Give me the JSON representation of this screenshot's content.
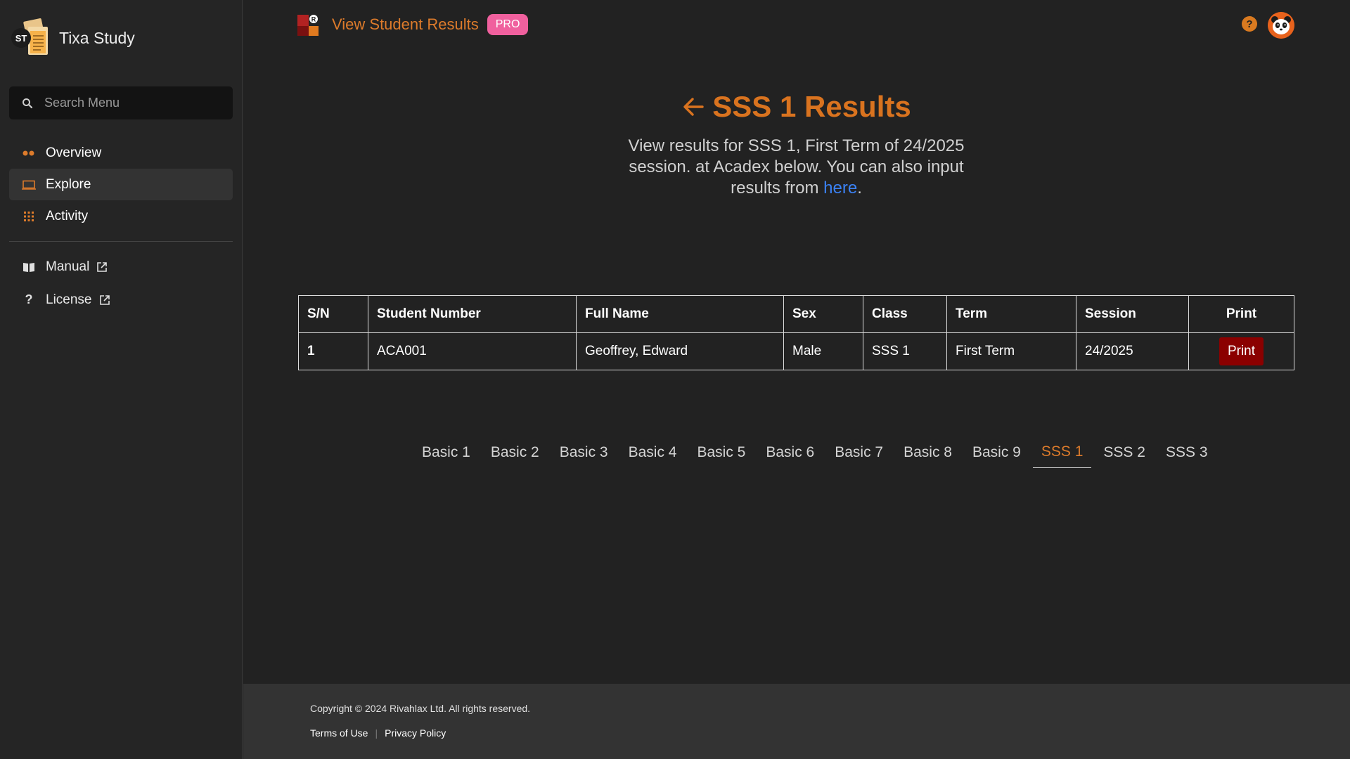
{
  "brand": {
    "logo_initials": "ST",
    "name": "Tixa Study"
  },
  "search": {
    "placeholder": "Search Menu"
  },
  "sidebar": {
    "items": [
      {
        "label": "Overview",
        "icon": "dots-icon",
        "active": false
      },
      {
        "label": "Explore",
        "icon": "laptop-icon",
        "active": true
      },
      {
        "label": "Activity",
        "icon": "grid-icon",
        "active": false
      }
    ],
    "links": [
      {
        "label": "Manual",
        "icon": "book-icon"
      },
      {
        "label": "License",
        "icon": "question-icon"
      }
    ]
  },
  "header": {
    "title": "View Student Results",
    "badge": "PRO"
  },
  "page": {
    "heading": "SSS 1 Results",
    "subtitle_text": "View results for SSS 1, First Term of 24/2025 session. at Acadex below. You can also input results from ",
    "subtitle_link": "here",
    "subtitle_end": "."
  },
  "table": {
    "headers": [
      "S/N",
      "Student Number",
      "Full Name",
      "Sex",
      "Class",
      "Term",
      "Session",
      "Print"
    ],
    "rows": [
      {
        "sn": "1",
        "student_number": "ACA001",
        "full_name": "Geoffrey, Edward",
        "sex": "Male",
        "class": "SSS 1",
        "term": "First Term",
        "session": "24/2025",
        "print_label": "Print"
      }
    ]
  },
  "class_tabs": {
    "items": [
      "Basic 1",
      "Basic 2",
      "Basic 3",
      "Basic 4",
      "Basic 5",
      "Basic 6",
      "Basic 7",
      "Basic 8",
      "Basic 9",
      "SSS 1",
      "SSS 2",
      "SSS 3"
    ],
    "active": "SSS 1"
  },
  "footer": {
    "copyright": "Copyright © 2024 Rivahlax Ltd. All rights reserved.",
    "terms": "Terms of Use",
    "privacy": "Privacy Policy"
  },
  "colors": {
    "accent": "#dd7b2b",
    "badge": "#f0609e",
    "print_button": "#8b0000",
    "link": "#3b82f6"
  }
}
